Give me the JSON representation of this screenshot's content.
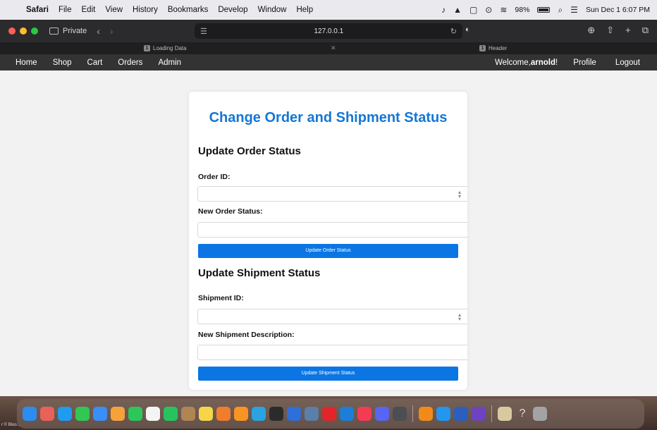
{
  "menubar": {
    "apple": "",
    "items": [
      "Safari",
      "File",
      "Edit",
      "View",
      "History",
      "Bookmarks",
      "Develop",
      "Window",
      "Help"
    ],
    "battery": "98%",
    "clock": "Sun Dec 1  6:07 PM"
  },
  "toolbar": {
    "private_label": "Private",
    "url": "127.0.0.1"
  },
  "tabs": [
    {
      "num": "1",
      "label": "Loading Data"
    },
    {
      "num": "1",
      "label": "Header"
    }
  ],
  "navbar": {
    "links": [
      "Home",
      "Shop",
      "Cart",
      "Orders",
      "Admin"
    ],
    "welcome_prefix": "Welcome,",
    "username": "arnold",
    "welcome_suffix": "!",
    "profile": "Profile",
    "logout": "Logout"
  },
  "form": {
    "title": "Change Order and Shipment Status",
    "order_section": "Update Order Status",
    "order_id_label": "Order ID:",
    "order_status_label": "New Order Status:",
    "order_button": "Update Order Status",
    "shipment_section": "Update Shipment Status",
    "shipment_id_label": "Shipment ID:",
    "shipment_desc_label": "New Shipment Description:",
    "shipment_button": "Update Shipment Status"
  },
  "dock": {
    "corner_text": "r © Bloo...",
    "apps": [
      {
        "name": "finder-icon",
        "color": "#2d8cf0"
      },
      {
        "name": "launchpad-icon",
        "color": "#e8625a"
      },
      {
        "name": "safari-icon",
        "color": "#1f9bf0"
      },
      {
        "name": "messages-icon",
        "color": "#32c653"
      },
      {
        "name": "mail-icon",
        "color": "#3a8ef6"
      },
      {
        "name": "photos-icon",
        "color": "#f6a23b"
      },
      {
        "name": "facetime-icon",
        "color": "#2ec55a"
      },
      {
        "name": "calendar-icon",
        "color": "#f4f4f4"
      },
      {
        "name": "whatsapp-icon",
        "color": "#27c45e"
      },
      {
        "name": "contacts-icon",
        "color": "#b08554"
      },
      {
        "name": "notes-icon",
        "color": "#f7d54a"
      },
      {
        "name": "pasta-icon",
        "color": "#f07d2b"
      },
      {
        "name": "sublime-icon",
        "color": "#f79422"
      },
      {
        "name": "telegram-icon",
        "color": "#2aa3e0"
      },
      {
        "name": "chatgpt-icon",
        "color": "#2b2b2b"
      },
      {
        "name": "cursor-icon",
        "color": "#2e6fd8"
      },
      {
        "name": "disk-icon",
        "color": "#5a7fa8"
      },
      {
        "name": "acrobat-icon",
        "color": "#e0262a"
      },
      {
        "name": "vscode-icon",
        "color": "#1c7ed6"
      },
      {
        "name": "music-icon",
        "color": "#f43b54"
      },
      {
        "name": "discord-icon",
        "color": "#5865f2"
      },
      {
        "name": "books-icon",
        "color": "#4b4e53"
      },
      {
        "name": "vlc-icon",
        "color": "#f28a1a"
      },
      {
        "name": "docker-icon",
        "color": "#2396ed"
      },
      {
        "name": "word-icon",
        "color": "#2b5fbd"
      },
      {
        "name": "github-icon",
        "color": "#6f42c1"
      },
      {
        "name": "preview-icon",
        "color": "#d8c9a0"
      },
      {
        "name": "help-icon",
        "color": "transparent"
      },
      {
        "name": "trash-icon",
        "color": "#a3a3a6"
      }
    ]
  }
}
